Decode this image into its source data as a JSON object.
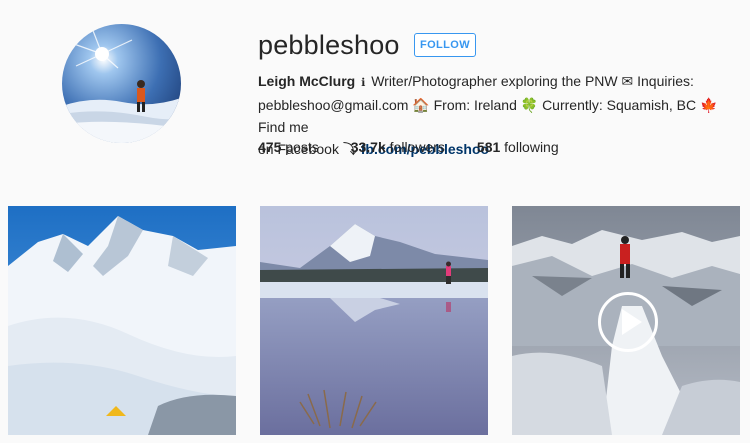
{
  "profile": {
    "username": "pebbleshoo",
    "follow_label": "FOLLOW",
    "full_name": "Leigh McClurg",
    "info_glyph": "ℹ",
    "bio_line1": "Writer/Photographer exploring the PNW ✉ Inquiries:",
    "bio_line2": "pebbleshoo@gmail.com 🏠 From: Ireland 🍀 Currently: Squamish, BC 🍁 Find me",
    "bio_line3": "on Facebook ⤵",
    "link_text": "fb.com/pebbleshoo"
  },
  "stats": {
    "posts_count": "475",
    "posts_label": "posts",
    "followers_count": "33.7k",
    "followers_label": "followers",
    "following_count": "581",
    "following_label": "following"
  },
  "posts": [
    {
      "kind": "photo",
      "subject": "snowy-mountain-tent"
    },
    {
      "kind": "photo",
      "subject": "mountain-lake-reflection"
    },
    {
      "kind": "video",
      "subject": "snow-ridge-hiker",
      "overlay_icon": "play-icon"
    }
  ],
  "colors": {
    "accent": "#3897f0",
    "link": "#003569",
    "text": "#262626",
    "background": "#fafafa"
  }
}
